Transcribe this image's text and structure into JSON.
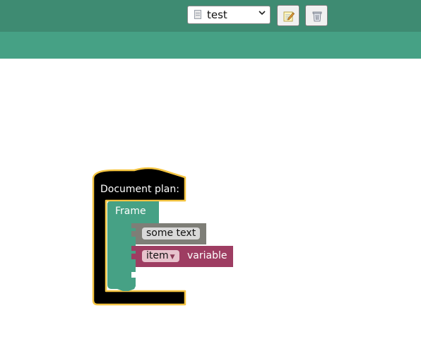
{
  "toolbar": {
    "document_select": {
      "selected": "test",
      "icon": "document-icon"
    },
    "edit_button": {
      "icon": "edit-note-icon"
    },
    "delete_button": {
      "icon": "trash-icon"
    }
  },
  "workspace": {
    "document_plan_block": {
      "label": "Document plan:",
      "color": "#000000",
      "highlight": "#f5c542"
    },
    "frame_block": {
      "label": "Frame",
      "color": "#46a185"
    },
    "text_block": {
      "value": "some text",
      "color": "#7e7e77"
    },
    "variable_block": {
      "dropdown_value": "item",
      "label": "variable",
      "color": "#9e3d62"
    }
  }
}
